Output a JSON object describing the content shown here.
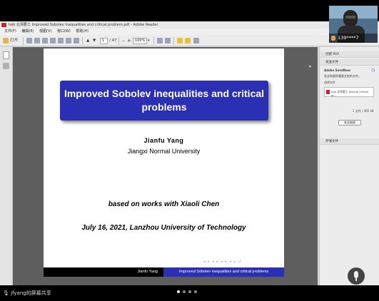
{
  "window": {
    "title": "talk 北师要工 Improved Sobolev inequalities and critical problem.pdf - Adobe Reader",
    "menu": [
      "文件(F)",
      "编辑(E)",
      "视图(V)",
      "窗口(W)",
      "帮助(H)"
    ]
  },
  "toolbar": {
    "open_label": "打开",
    "page_current": "1",
    "page_total": "/ 47",
    "zoom": "100%"
  },
  "slide": {
    "title": "Improved Sobolev inequalities and critical problems",
    "author": "Jianfu Yang",
    "affiliation": "Jiangxi Normal University",
    "based_on": "based on works with Xiaoli Chen",
    "date_line": "July 16, 2021, Lanzhou University of Technology",
    "footer_left": "Jianfu Yang",
    "footer_right": "Improved Sobolev inequalities and critical problems",
    "nav_symbols": "◂ ▸ ◂ ▸ ◂ ▸ ◂ ▸ ↺"
  },
  "panel": {
    "section1": "创建 PDF",
    "section2": "发送文件",
    "send_service": "Adobe SendNow",
    "send_hint": "发送和跟踪重要文档的文件。",
    "select_file": "选择文件",
    "file_name": "talk 北师要工 Double critical pr...",
    "file_count": "1 文件 / 465 kB",
    "send_button": "发送链接",
    "section3": "存储文件"
  },
  "meeting": {
    "participant_name": "139****7",
    "share_label": "jfyang的屏幕共享"
  },
  "colors": {
    "slide_blue": "#2a2fb3",
    "doc_background": "#5e5e5e",
    "window_chrome": "#ececec"
  }
}
